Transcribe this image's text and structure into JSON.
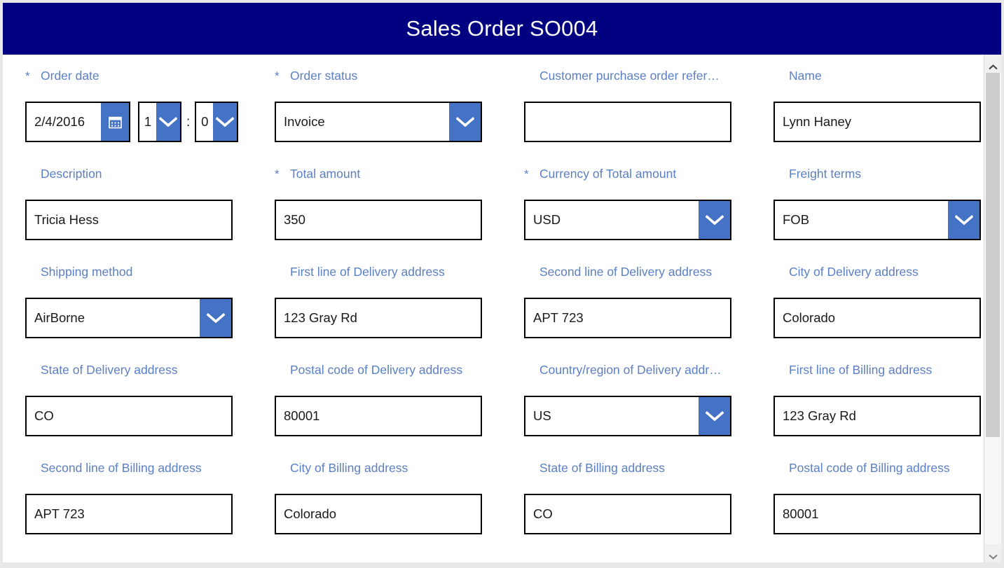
{
  "window": {
    "title": "Sales Order SO004",
    "title_bar_color": "#000080",
    "accent_color": "#4472C4",
    "label_color": "#5B7FC4"
  },
  "scrollbar": {
    "up_arrow": "chevron-up-icon",
    "down_arrow": "chevron-down-icon"
  },
  "form": {
    "required_marker": "*",
    "fields": [
      {
        "name": "order-date",
        "label": "Order date",
        "required": true,
        "type": "datetime",
        "date_value": "2/4/2016",
        "hour_value": "1",
        "minute_value": "0",
        "separator": ":",
        "calendar_icon": "calendar-icon"
      },
      {
        "name": "order-status",
        "label": "Order status",
        "required": true,
        "type": "combobox",
        "value": "Invoice"
      },
      {
        "name": "customer-purchase-order-reference",
        "label": "Customer purchase order refer…",
        "required": false,
        "type": "textbox",
        "value": ""
      },
      {
        "name": "name",
        "label": "Name",
        "required": false,
        "type": "textbox",
        "value": "Lynn Haney"
      },
      {
        "name": "description",
        "label": "Description",
        "required": false,
        "type": "textbox",
        "value": "Tricia Hess"
      },
      {
        "name": "total-amount",
        "label": "Total amount",
        "required": true,
        "type": "textbox",
        "value": "350"
      },
      {
        "name": "currency-of-total-amount",
        "label": "Currency of Total amount",
        "required": true,
        "type": "combobox",
        "value": "USD"
      },
      {
        "name": "freight-terms",
        "label": "Freight terms",
        "required": false,
        "type": "combobox",
        "value": "FOB"
      },
      {
        "name": "shipping-method",
        "label": "Shipping method",
        "required": false,
        "type": "combobox",
        "value": "AirBorne"
      },
      {
        "name": "first-line-of-delivery-address",
        "label": "First line of Delivery address",
        "required": false,
        "type": "textbox",
        "value": "123 Gray Rd"
      },
      {
        "name": "second-line-of-delivery-address",
        "label": "Second line of Delivery address",
        "required": false,
        "type": "textbox",
        "value": "APT 723"
      },
      {
        "name": "city-of-delivery-address",
        "label": "City of Delivery address",
        "required": false,
        "type": "textbox",
        "value": "Colorado"
      },
      {
        "name": "state-of-delivery-address",
        "label": "State of Delivery address",
        "required": false,
        "type": "textbox",
        "value": "CO"
      },
      {
        "name": "postal-code-of-delivery-address",
        "label": "Postal code of Delivery address",
        "required": false,
        "type": "textbox",
        "value": "80001"
      },
      {
        "name": "country-region-of-delivery-address",
        "label": "Country/region of Delivery addr…",
        "required": false,
        "type": "combobox",
        "value": "US"
      },
      {
        "name": "first-line-of-billing-address",
        "label": "First line of Billing address",
        "required": false,
        "type": "textbox",
        "value": "123 Gray Rd"
      },
      {
        "name": "second-line-of-billing-address",
        "label": "Second line of Billing address",
        "required": false,
        "type": "textbox",
        "value": "APT 723"
      },
      {
        "name": "city-of-billing-address",
        "label": "City of Billing address",
        "required": false,
        "type": "textbox",
        "value": "Colorado"
      },
      {
        "name": "state-of-billing-address",
        "label": "State of Billing address",
        "required": false,
        "type": "textbox",
        "value": "CO"
      },
      {
        "name": "postal-code-of-billing-address",
        "label": "Postal code of Billing address",
        "required": false,
        "type": "textbox",
        "value": "80001"
      }
    ]
  }
}
